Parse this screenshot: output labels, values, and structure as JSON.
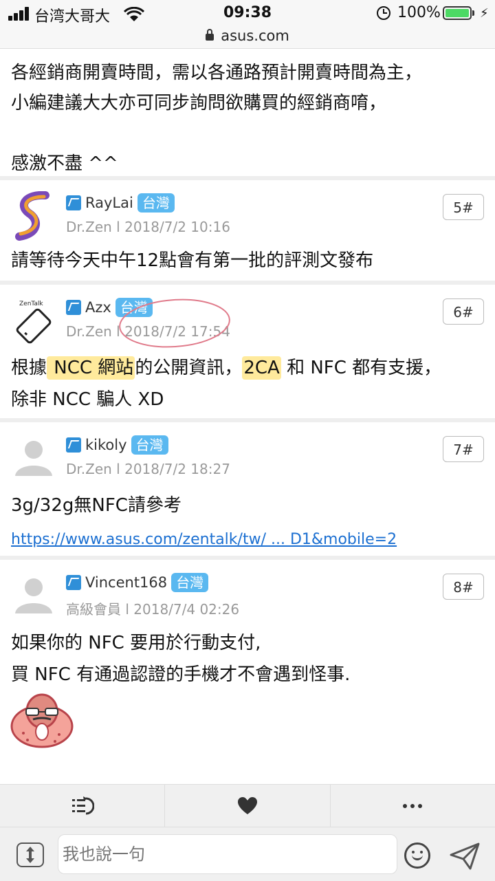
{
  "status_bar": {
    "carrier": "台湾大哥大",
    "time": "09:38",
    "battery": "100%"
  },
  "url_bar": {
    "domain": "asus.com"
  },
  "intro": {
    "lines": [
      "各經銷商開賣時間，需以各通路預計開賣時間為主，",
      "小編建議大大亦可同步詢問欲購買的經銷商唷，",
      "",
      "感激不盡 ^^"
    ]
  },
  "posts": [
    {
      "name": "RayLai",
      "region": "台灣",
      "meta": "Dr.Zen l 2018/7/2 10:16",
      "floor": "5#",
      "avatar": "swirl-logo-avatar",
      "body": [
        "請等待今天中午12點會有第一批的評測文發布"
      ]
    },
    {
      "name": "Azx",
      "region": "台灣",
      "meta": "Dr.Zen l 2018/7/2 17:54",
      "floor": "6#",
      "avatar": "zentalk-phone-avatar",
      "avatar_text": "ZenTalk",
      "body_parts": {
        "p1": "根據",
        "hl1": " NCC 網站",
        "p2": "的公開資訊，",
        "hl2": "2CA",
        "p3": " 和 NFC 都有支援，"
      },
      "body2": "除非 NCC 騙人 XD"
    },
    {
      "name": "kikoly",
      "region": "台灣",
      "meta": "Dr.Zen l 2018/7/2 18:27",
      "floor": "7#",
      "avatar": "default-user-avatar",
      "body": [
        "3g/32g無NFC請參考"
      ],
      "link": "https://www.asus.com/zentalk/tw/ ... D1&mobile=2"
    },
    {
      "name": "Vincent168",
      "region": "台灣",
      "meta": "高級會員 l 2018/7/4 02:26",
      "floor": "8#",
      "avatar": "default-user-avatar",
      "body": [
        "如果你的 NFC 要用於行動支付,",
        "買 NFC 有通過認證的手機才不會遇到怪事."
      ],
      "sticker": "monkey-sticker"
    }
  ],
  "action_bar": {
    "icons": [
      "reply-list-icon",
      "heart-icon",
      "more-icon"
    ]
  },
  "input_bar": {
    "placeholder": "我也說一句"
  },
  "colors": {
    "accent": "#5ab8f0",
    "link": "#1b6fd1",
    "highlight": "#ffdc5a"
  }
}
